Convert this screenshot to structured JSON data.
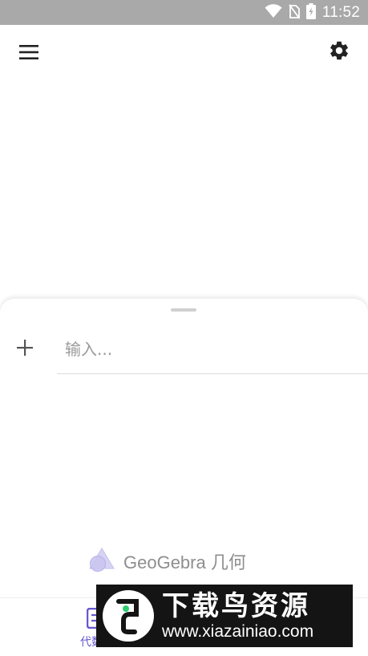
{
  "status_bar": {
    "time": "11:52",
    "icons": [
      "wifi-icon",
      "no-sim-icon",
      "battery-charging-icon"
    ],
    "background": "#a9a9a9"
  },
  "toolbar": {
    "menu_icon": "hamburger-menu-icon",
    "settings_icon": "gear-icon"
  },
  "algebra_panel": {
    "add_icon": "plus-icon",
    "input_placeholder": "输入..."
  },
  "brand": {
    "logo_icon": "geogebra-geometry-logo-icon",
    "label": "GeoGebra 几何"
  },
  "bottom_nav": {
    "tabs": [
      {
        "label": "代数",
        "icon": "algebra-icon",
        "active": true
      }
    ],
    "active_color": "#6557d2"
  },
  "watermark": {
    "title": "下载鸟资源",
    "url": "www.xiazainiao.com"
  }
}
